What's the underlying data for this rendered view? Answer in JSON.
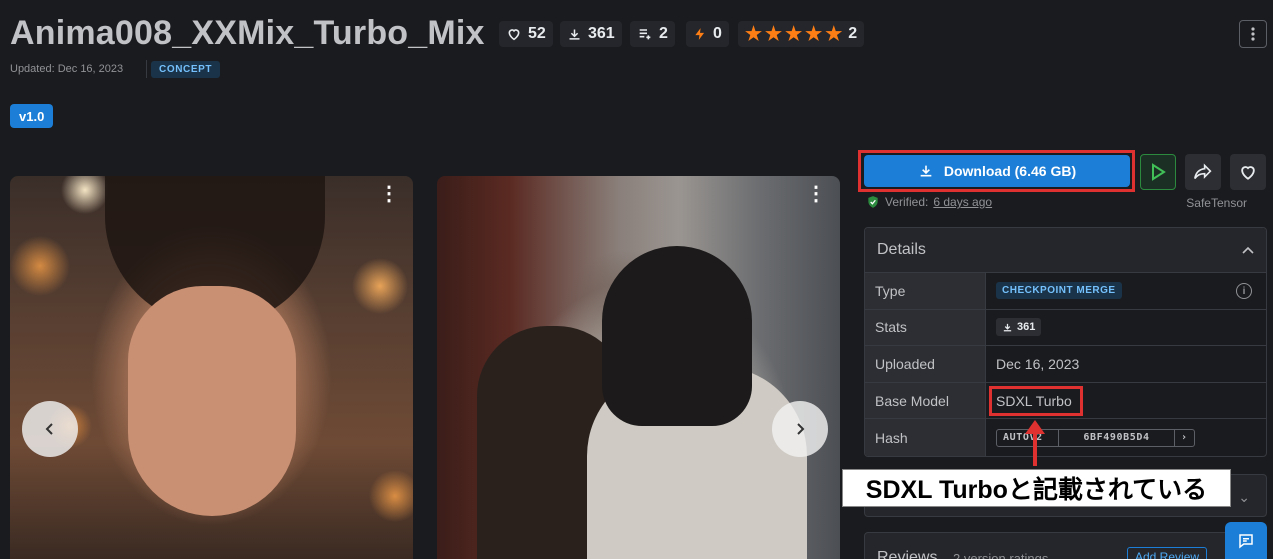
{
  "header": {
    "title": "Anima008_XXMix_Turbo_Mix",
    "likes": "52",
    "downloads": "361",
    "collections": "2",
    "buzz": "0",
    "rating_count": "2",
    "rating_stars": 5,
    "updated": "Updated: Dec 16, 2023",
    "category": "CONCEPT"
  },
  "version": "v1.0",
  "gallery": {
    "prev_icon": "chevron-left-icon",
    "next_icon": "chevron-right-icon",
    "more_icon": "more-vertical-icon"
  },
  "actions": {
    "download_label": "Download (6.46 GB)",
    "verified_prefix": "Verified:",
    "verified_time": "6 days ago",
    "file_format": "SafeTensor"
  },
  "details": {
    "heading": "Details",
    "rows": {
      "type_key": "Type",
      "type_value": "CHECKPOINT MERGE",
      "stats_key": "Stats",
      "stats_value": "361",
      "uploaded_key": "Uploaded",
      "uploaded_value": "Dec 16, 2023",
      "base_key": "Base Model",
      "base_value": "SDXL Turbo",
      "hash_key": "Hash",
      "hash_algo": "AUTOV2",
      "hash_value": "6BF490B5D4"
    }
  },
  "annotation": {
    "callout": "SDXL Turboと記載されている",
    "highlight_color": "#e03131"
  },
  "reviews": {
    "heading": "Reviews",
    "subtitle": "2 version ratings",
    "add_label": "Add Review"
  },
  "colors": {
    "accent": "#1c7ed6",
    "star": "#fd7e14",
    "background": "#1a1b1e"
  }
}
